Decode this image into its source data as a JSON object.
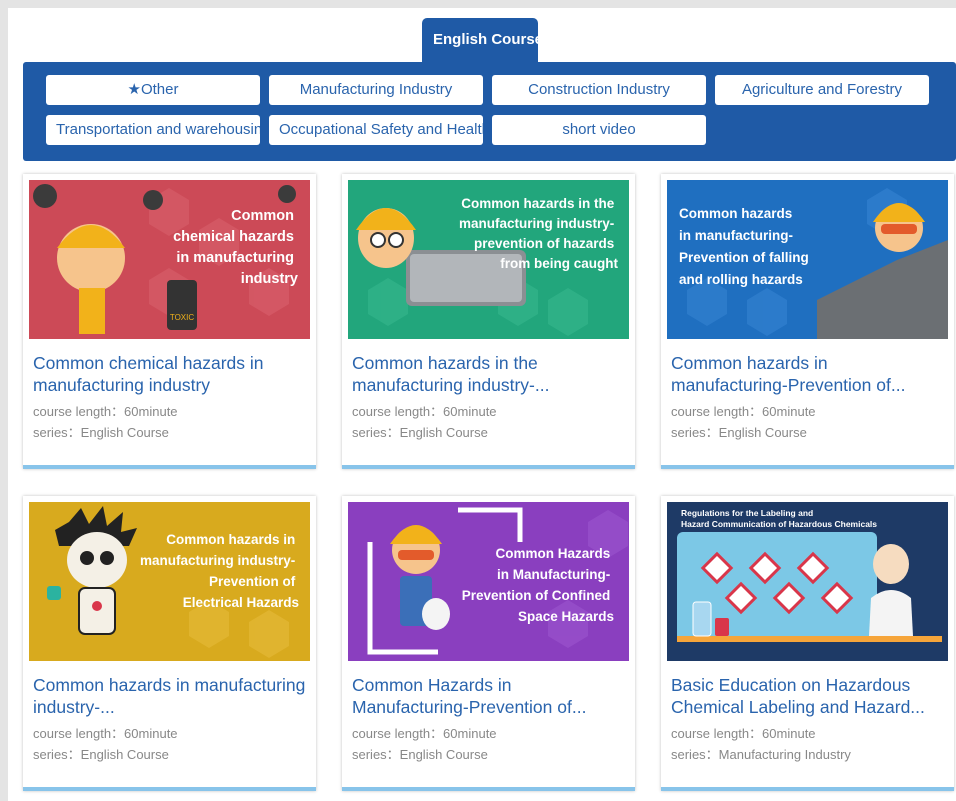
{
  "tab": {
    "label": "English Course"
  },
  "categories": [
    {
      "label": "★Other"
    },
    {
      "label": "Manufacturing Industry"
    },
    {
      "label": "Construction Industry"
    },
    {
      "label": "Agriculture and Forestry"
    },
    {
      "label": "Transportation and warehousing"
    },
    {
      "label": "Occupational Safety and Health"
    },
    {
      "label": "short video"
    }
  ],
  "courses": [
    {
      "title": "Common chemical hazards in manufacturing industry",
      "length": "course length：60minute",
      "series": "series：English Course",
      "thumb_lines": [
        "Common",
        "chemical hazards",
        "in manufacturing",
        "industry"
      ],
      "thumb_badge": "TOXIC",
      "thumb_color": "#cc4a57"
    },
    {
      "title": "Common hazards in the manufacturing industry-...",
      "length": "course length：60minute",
      "series": "series：English Course",
      "thumb_lines": [
        "Common hazards in the",
        "manufacturing industry-",
        "prevention of hazards",
        "from being caught"
      ],
      "thumb_color": "#22a67c"
    },
    {
      "title": "Common hazards in manufacturing-Prevention of...",
      "length": "course length：60minute",
      "series": "series：English Course",
      "thumb_lines": [
        "Common hazards",
        "in manufacturing-",
        "Prevention of falling",
        "and rolling hazards"
      ],
      "thumb_color": "#1f6fc0"
    },
    {
      "title": "Common hazards in manufacturing industry-...",
      "length": "course length：60minute",
      "series": "series：English Course",
      "thumb_lines": [
        "Common hazards in",
        "manufacturing industry-",
        "Prevention of",
        "Electrical Hazards"
      ],
      "thumb_color": "#d8aa1e"
    },
    {
      "title": "Common Hazards in Manufacturing-Prevention of...",
      "length": "course length：60minute",
      "series": "series：English Course",
      "thumb_lines": [
        "Common Hazards",
        "in Manufacturing-",
        "Prevention of Confined",
        "Space Hazards"
      ],
      "thumb_color": "#8a3fbf"
    },
    {
      "title": "Basic Education on Hazardous Chemical Labeling and Hazard...",
      "length": "course length：60minute",
      "series": "series：Manufacturing Industry",
      "thumb_lines": [
        "Regulations for the Labeling and",
        "Hazard Communication of Hazardous Chemicals"
      ],
      "thumb_color": "#1e3a66"
    }
  ]
}
